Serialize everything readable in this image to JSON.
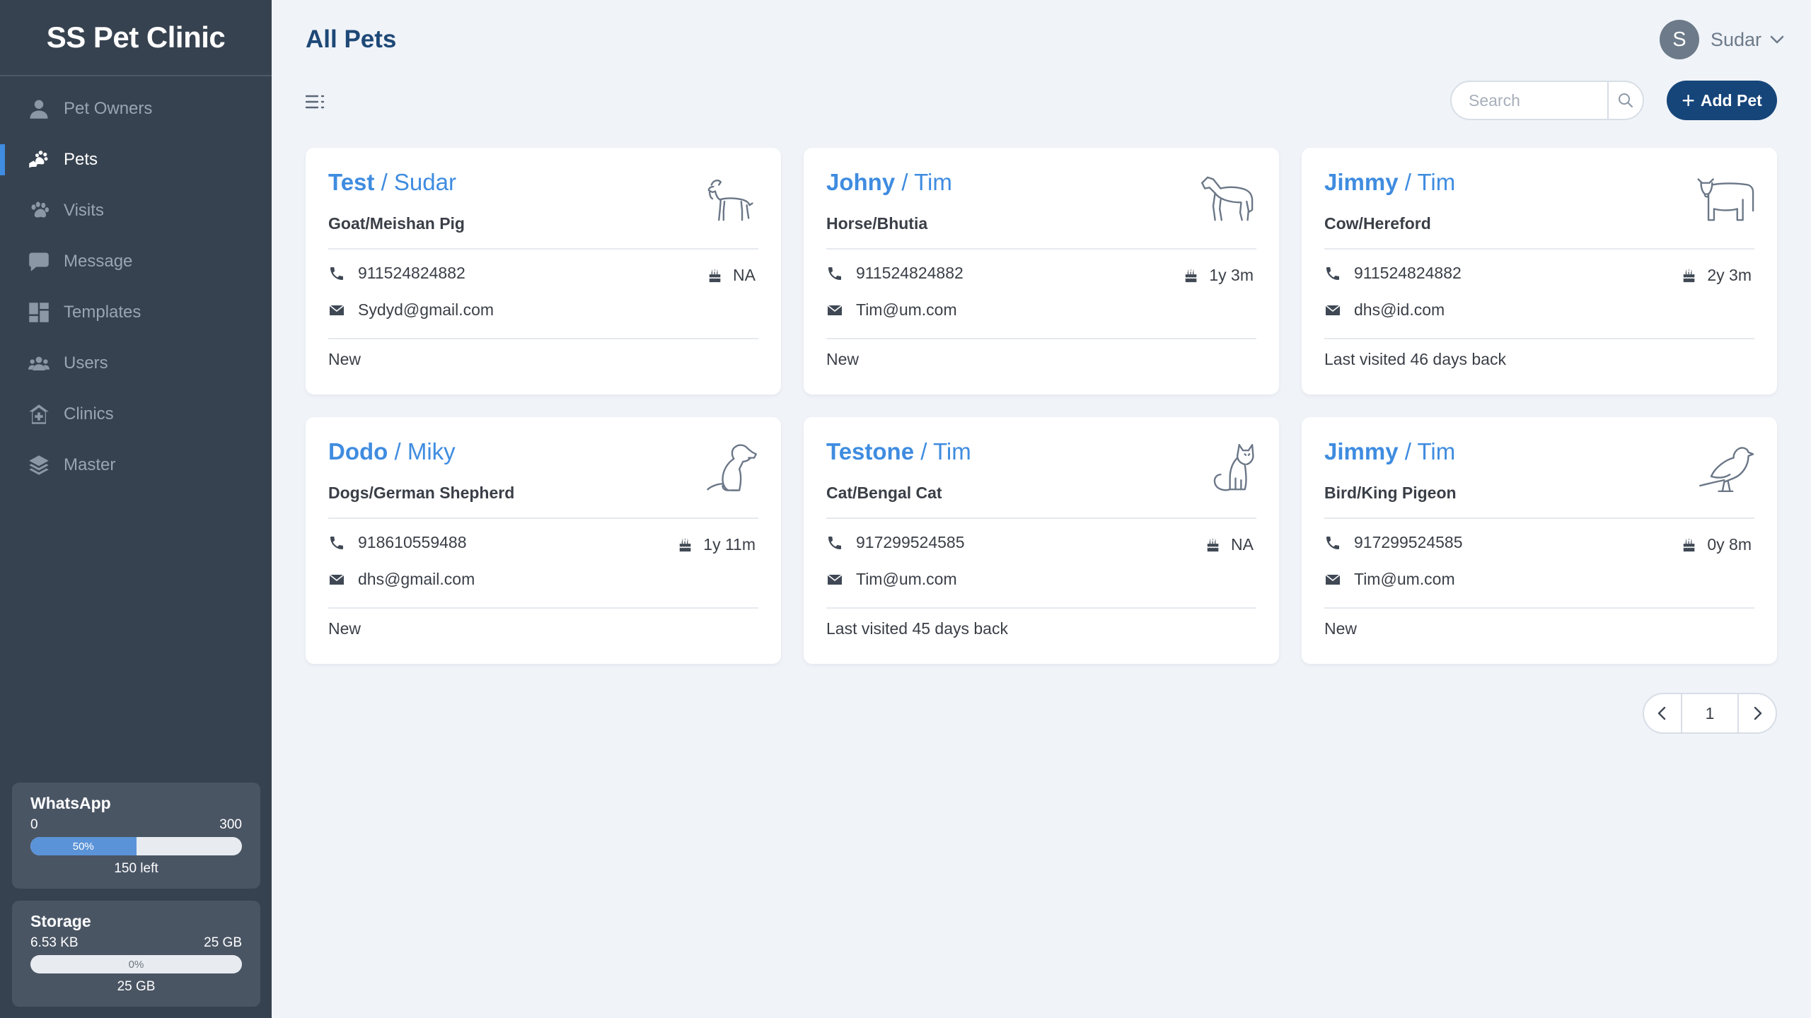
{
  "app": {
    "title": "SS Pet Clinic"
  },
  "sidebar": {
    "items": [
      {
        "label": "Pet Owners",
        "icon": "user-icon",
        "active": false
      },
      {
        "label": "Pets",
        "icon": "pet-hand-icon",
        "active": true
      },
      {
        "label": "Visits",
        "icon": "paw-icon",
        "active": false
      },
      {
        "label": "Message",
        "icon": "chat-icon",
        "active": false
      },
      {
        "label": "Templates",
        "icon": "grid-icon",
        "active": false
      },
      {
        "label": "Users",
        "icon": "users-icon",
        "active": false
      },
      {
        "label": "Clinics",
        "icon": "clinic-icon",
        "active": false
      },
      {
        "label": "Master",
        "icon": "layers-icon",
        "active": false
      }
    ],
    "whatsapp": {
      "title": "WhatsApp",
      "min": "0",
      "max": "300",
      "percent_label": "50%",
      "percent": 50,
      "footer": "150 left"
    },
    "storage": {
      "title": "Storage",
      "used": "6.53 KB",
      "total": "25 GB",
      "percent_label": "0%",
      "percent": 0,
      "footer": "25 GB"
    }
  },
  "header": {
    "title": "All Pets",
    "user": {
      "initial": "S",
      "name": "Sudar"
    }
  },
  "toolbar": {
    "search_placeholder": "Search",
    "add_label": "Add Pet"
  },
  "pets": [
    {
      "pet": "Test",
      "sep": " / ",
      "owner": "Sudar",
      "breed": "Goat/Meishan Pig",
      "animal": "goat-icon",
      "phone": "911524824882",
      "email": "Sydyd@gmail.com",
      "age": "NA",
      "status": "New"
    },
    {
      "pet": "Johny",
      "sep": " / ",
      "owner": "Tim",
      "breed": "Horse/Bhutia",
      "animal": "horse-icon",
      "phone": "911524824882",
      "email": "Tim@um.com",
      "age": "1y 3m",
      "status": "New"
    },
    {
      "pet": "Jimmy",
      "sep": " / ",
      "owner": "Tim",
      "breed": "Cow/Hereford",
      "animal": "cow-icon",
      "phone": "911524824882",
      "email": "dhs@id.com",
      "age": "2y 3m",
      "status": "Last visited 46 days back"
    },
    {
      "pet": "Dodo",
      "sep": " / ",
      "owner": "Miky",
      "breed": "Dogs/German Shepherd",
      "animal": "dog-icon",
      "phone": "918610559488",
      "email": "dhs@gmail.com",
      "age": "1y 11m",
      "status": "New"
    },
    {
      "pet": "Testone",
      "sep": " / ",
      "owner": "Tim",
      "breed": "Cat/Bengal Cat",
      "animal": "cat-icon",
      "phone": "917299524585",
      "email": "Tim@um.com",
      "age": "NA",
      "status": "Last visited 45 days back"
    },
    {
      "pet": "Jimmy",
      "sep": " / ",
      "owner": "Tim",
      "breed": "Bird/King Pigeon",
      "animal": "bird-icon",
      "phone": "917299524585",
      "email": "Tim@um.com",
      "age": "0y 8m",
      "status": "New"
    }
  ],
  "pagination": {
    "current": "1"
  },
  "colors": {
    "sidebar_bg": "#374250",
    "accent": "#3f8ce0",
    "primary_button": "#16457a",
    "page_bg": "#f0f3f8"
  }
}
